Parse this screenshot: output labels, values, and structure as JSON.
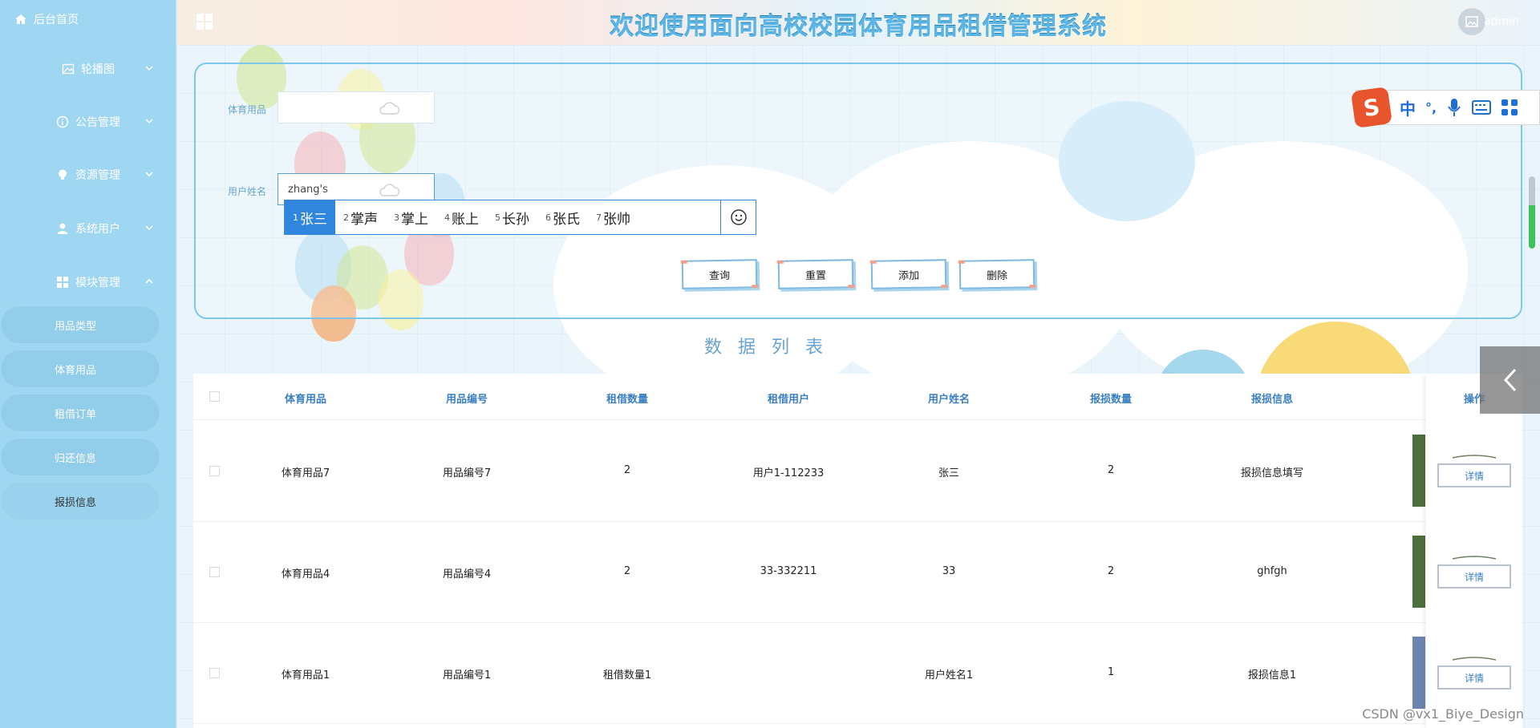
{
  "app": {
    "title": "欢迎使用面向高校校园体育用品租借管理系统",
    "user": "admin"
  },
  "sidebar": {
    "home": "后台首页",
    "groups": [
      {
        "label": "轮播图",
        "icon": "image-icon"
      },
      {
        "label": "公告管理",
        "icon": "info-circle-icon"
      },
      {
        "label": "资源管理",
        "icon": "bulb-icon"
      },
      {
        "label": "系统用户",
        "icon": "user-icon"
      },
      {
        "label": "模块管理",
        "icon": "grid-icon"
      }
    ],
    "sub_items": [
      "用品类型",
      "体育用品",
      "租借订单",
      "归还信息",
      "报损信息"
    ]
  },
  "search": {
    "field1_label": "体育用品",
    "field1_value": "",
    "field2_label": "用户姓名",
    "field2_value": "zhang's",
    "buttons": {
      "query": "查询",
      "reset": "重置",
      "add": "添加",
      "delete": "删除"
    }
  },
  "ime": {
    "candidates": [
      {
        "n": "1",
        "text": "张三"
      },
      {
        "n": "2",
        "text": "掌声"
      },
      {
        "n": "3",
        "text": "掌上"
      },
      {
        "n": "4",
        "text": "账上"
      },
      {
        "n": "5",
        "text": "长孙"
      },
      {
        "n": "6",
        "text": "张氏"
      },
      {
        "n": "7",
        "text": "张帅"
      }
    ],
    "toolbar": {
      "lang": "中",
      "punct": "°,",
      "logo": "S"
    }
  },
  "table": {
    "title": "数据列表",
    "headers": [
      "体育用品",
      "用品编号",
      "租借数量",
      "租借用户",
      "用户姓名",
      "报损数量",
      "报损信息",
      "操作"
    ],
    "rows": [
      [
        "体育用品7",
        "用品编号7",
        "2",
        "用户1-112233",
        "张三",
        "2",
        "报损信息填写"
      ],
      [
        "体育用品4",
        "用品编号4",
        "2",
        "33-332211",
        "33",
        "2",
        "ghfgh"
      ],
      [
        "体育用品1",
        "用品编号1",
        "租借数量1",
        "",
        "用户姓名1",
        "1",
        "报损信息1"
      ]
    ],
    "detail_label": "详情"
  },
  "watermark": "CSDN @vx1_Biye_Design",
  "colors": {
    "sidebar": "#9fd6f2",
    "accent": "#3a7fc1",
    "ime_selected": "#2f86dc"
  }
}
